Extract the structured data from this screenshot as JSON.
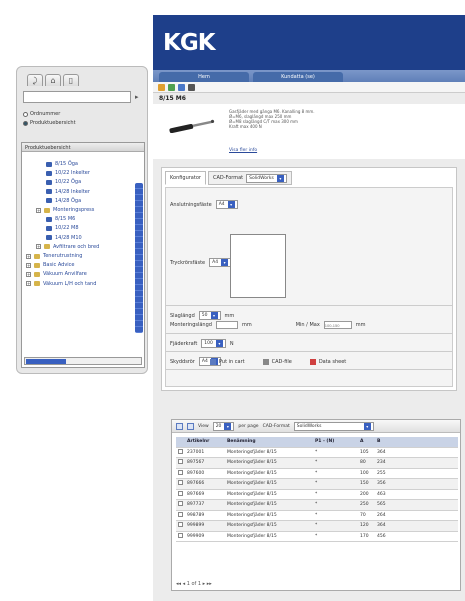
{
  "sidebar": {
    "search_placeholder": "",
    "radios": [
      {
        "label": "Ordnummer",
        "on": false
      },
      {
        "label": "Produktuebersicht",
        "on": true
      }
    ],
    "tree_header": "Produktuebersicht",
    "tree_items": [
      {
        "label": "8/15 Öga",
        "level": 2
      },
      {
        "label": "10/22 Inkelter",
        "level": 2
      },
      {
        "label": "10/22 Öga",
        "level": 2
      },
      {
        "label": "14/28 Inkelter",
        "level": 2
      },
      {
        "label": "14/28 Öga",
        "level": 2
      },
      {
        "label": "Monteringspress",
        "level": 1,
        "folder": true
      },
      {
        "label": "8/15 M6",
        "level": 2
      },
      {
        "label": "10/22 M8",
        "level": 2
      },
      {
        "label": "14/28 M10",
        "level": 2
      },
      {
        "label": "Avfiltrare och bred",
        "level": 1,
        "folder": true
      },
      {
        "label": "Tenerutrustning",
        "level": 0,
        "folder": true
      },
      {
        "label": "Basic Advice",
        "level": 0,
        "folder": true
      },
      {
        "label": "Väkuum Anvilfare",
        "level": 0,
        "folder": true
      },
      {
        "label": "Väkuum L/H och tand",
        "level": 0,
        "folder": true
      }
    ]
  },
  "header": {
    "logo": "KGK",
    "nav": [
      "Hem",
      "Kundatta (se)"
    ]
  },
  "product": {
    "title": "8/15 M6",
    "spec_lines": [
      "Gasfjäder med gänga M6. Kanalling 8 mm.",
      "Ø=M6, slaglängd max 250 mm",
      "Ø=M8 slaglängd C/T max 300 mm",
      "Kraft max 400 N"
    ],
    "more_link": "Visa fler info"
  },
  "config": {
    "tab_configurator": "Konfigurator",
    "tab_cad_label": "CAD-Format",
    "tab_cad_value": "SolidWorks",
    "fields": {
      "anslutning_label": "Anslutningsfäste",
      "anslutning_value": "A4",
      "tryck_label": "Tryckrörsfäste",
      "tryck_value": "A4",
      "slaglangd_label": "Slaglängd",
      "slaglangd_value": "50",
      "slaglangd_unit": "mm",
      "monteringslangd_label": "Monteringslängd",
      "monteringslangd_unit": "mm",
      "min_max_label": "Min / Max",
      "min_max_placeholder": "100-150",
      "kraft_label": "Fjäderkraft",
      "kraft_value": "100",
      "kraft_unit": "N",
      "tillbehor_label": "Skyddsrör",
      "tillbehor_value": "A4"
    },
    "actions": [
      "Put in cart",
      "CAD-file",
      "Data sheet"
    ]
  },
  "results": {
    "view_label": "View",
    "per_page_value": "20",
    "per_page_label": "per page",
    "cad_label": "CAD-Format",
    "cad_value": "SolidWorks",
    "columns": [
      "Artikelnr",
      "Benämning",
      "P1 - (N)",
      "A",
      "B"
    ],
    "rows": [
      [
        "237001",
        "Monteringsfjäder 8/15",
        "*",
        "105",
        "364"
      ],
      [
        "897567",
        "Monteringsfjäder 8/15",
        "*",
        "80",
        "234"
      ],
      [
        "897600",
        "Monteringsfjäder 8/15",
        "*",
        "100",
        "255"
      ],
      [
        "897666",
        "Monteringsfjäder 8/15",
        "*",
        "150",
        "356"
      ],
      [
        "897669",
        "Monteringsfjäder 8/15",
        "*",
        "200",
        "463"
      ],
      [
        "897737",
        "Monteringsfjäder 8/15",
        "*",
        "250",
        "565"
      ],
      [
        "998789",
        "Monteringsfjäder 8/15",
        "*",
        "70",
        "264"
      ],
      [
        "999899",
        "Monteringsfjäder 8/15",
        "*",
        "120",
        "364"
      ],
      [
        "999909",
        "Monteringsfjäder 8/15",
        "*",
        "170",
        "456"
      ]
    ],
    "pager": "◂◂ ◂ 1 of 1 ▸ ▸▸"
  }
}
